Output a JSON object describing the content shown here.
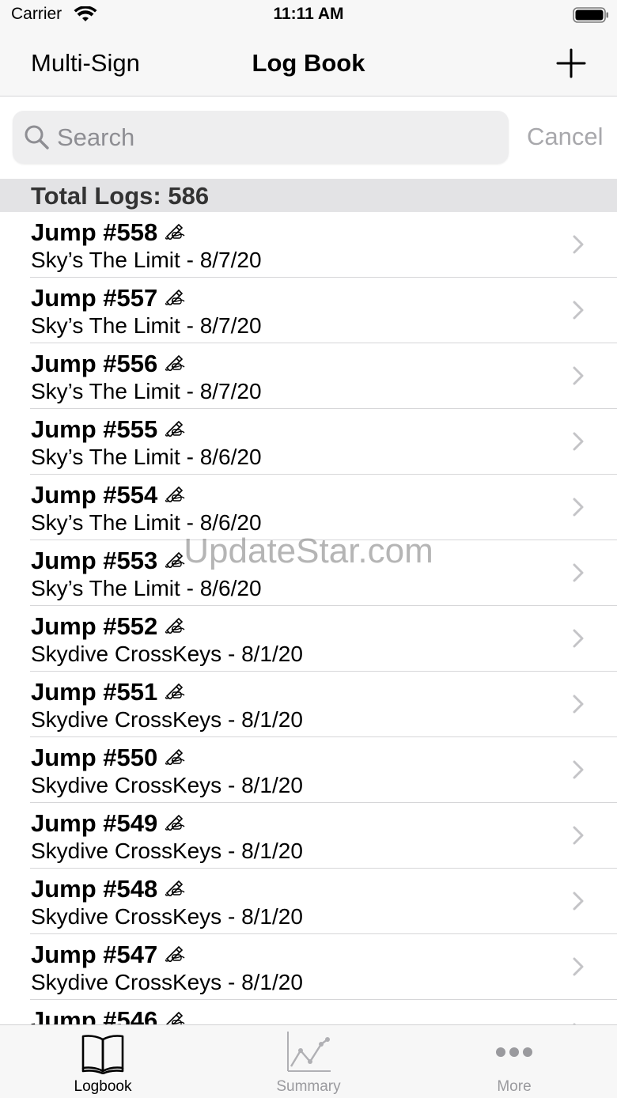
{
  "status": {
    "carrier": "Carrier",
    "time": "11:11 AM"
  },
  "nav": {
    "left_label": "Multi-Sign",
    "title": "Log Book"
  },
  "search": {
    "placeholder": "Search",
    "cancel_label": "Cancel"
  },
  "section": {
    "header": "Total Logs: 586"
  },
  "logs": [
    {
      "title": "Jump #558",
      "subtitle": "Sky’s The Limit - 8/7/20"
    },
    {
      "title": "Jump #557",
      "subtitle": "Sky’s The Limit - 8/7/20"
    },
    {
      "title": "Jump #556",
      "subtitle": "Sky’s The Limit - 8/7/20"
    },
    {
      "title": "Jump #555",
      "subtitle": "Sky’s The Limit - 8/6/20"
    },
    {
      "title": "Jump #554",
      "subtitle": "Sky’s The Limit - 8/6/20"
    },
    {
      "title": "Jump #553",
      "subtitle": "Sky’s The Limit - 8/6/20"
    },
    {
      "title": "Jump #552",
      "subtitle": "Skydive CrossKeys - 8/1/20"
    },
    {
      "title": "Jump #551",
      "subtitle": "Skydive CrossKeys - 8/1/20"
    },
    {
      "title": "Jump #550",
      "subtitle": "Skydive CrossKeys - 8/1/20"
    },
    {
      "title": "Jump #549",
      "subtitle": "Skydive CrossKeys - 8/1/20"
    },
    {
      "title": "Jump #548",
      "subtitle": "Skydive CrossKeys - 8/1/20"
    },
    {
      "title": "Jump #547",
      "subtitle": "Skydive CrossKeys - 8/1/20"
    },
    {
      "title": "Jump #546",
      "subtitle": ""
    }
  ],
  "watermark": "UpdateStar.com",
  "tabs": {
    "logbook": "Logbook",
    "summary": "Summary",
    "more": "More"
  },
  "icons": {
    "wifi": "wifi-icon",
    "battery": "battery-icon",
    "add": "plus-icon",
    "search": "search-icon",
    "sign": "writing-hand-icon",
    "chevron": "chevron-right-icon",
    "logbook_tab": "book-icon",
    "summary_tab": "chart-icon",
    "more_tab": "ellipsis-icon"
  },
  "colors": {
    "bar_background": "#f7f7f7",
    "section_background": "#e3e3e5",
    "secondary_text": "#8e8e93",
    "inactive_tab": "#9a9a9e"
  }
}
